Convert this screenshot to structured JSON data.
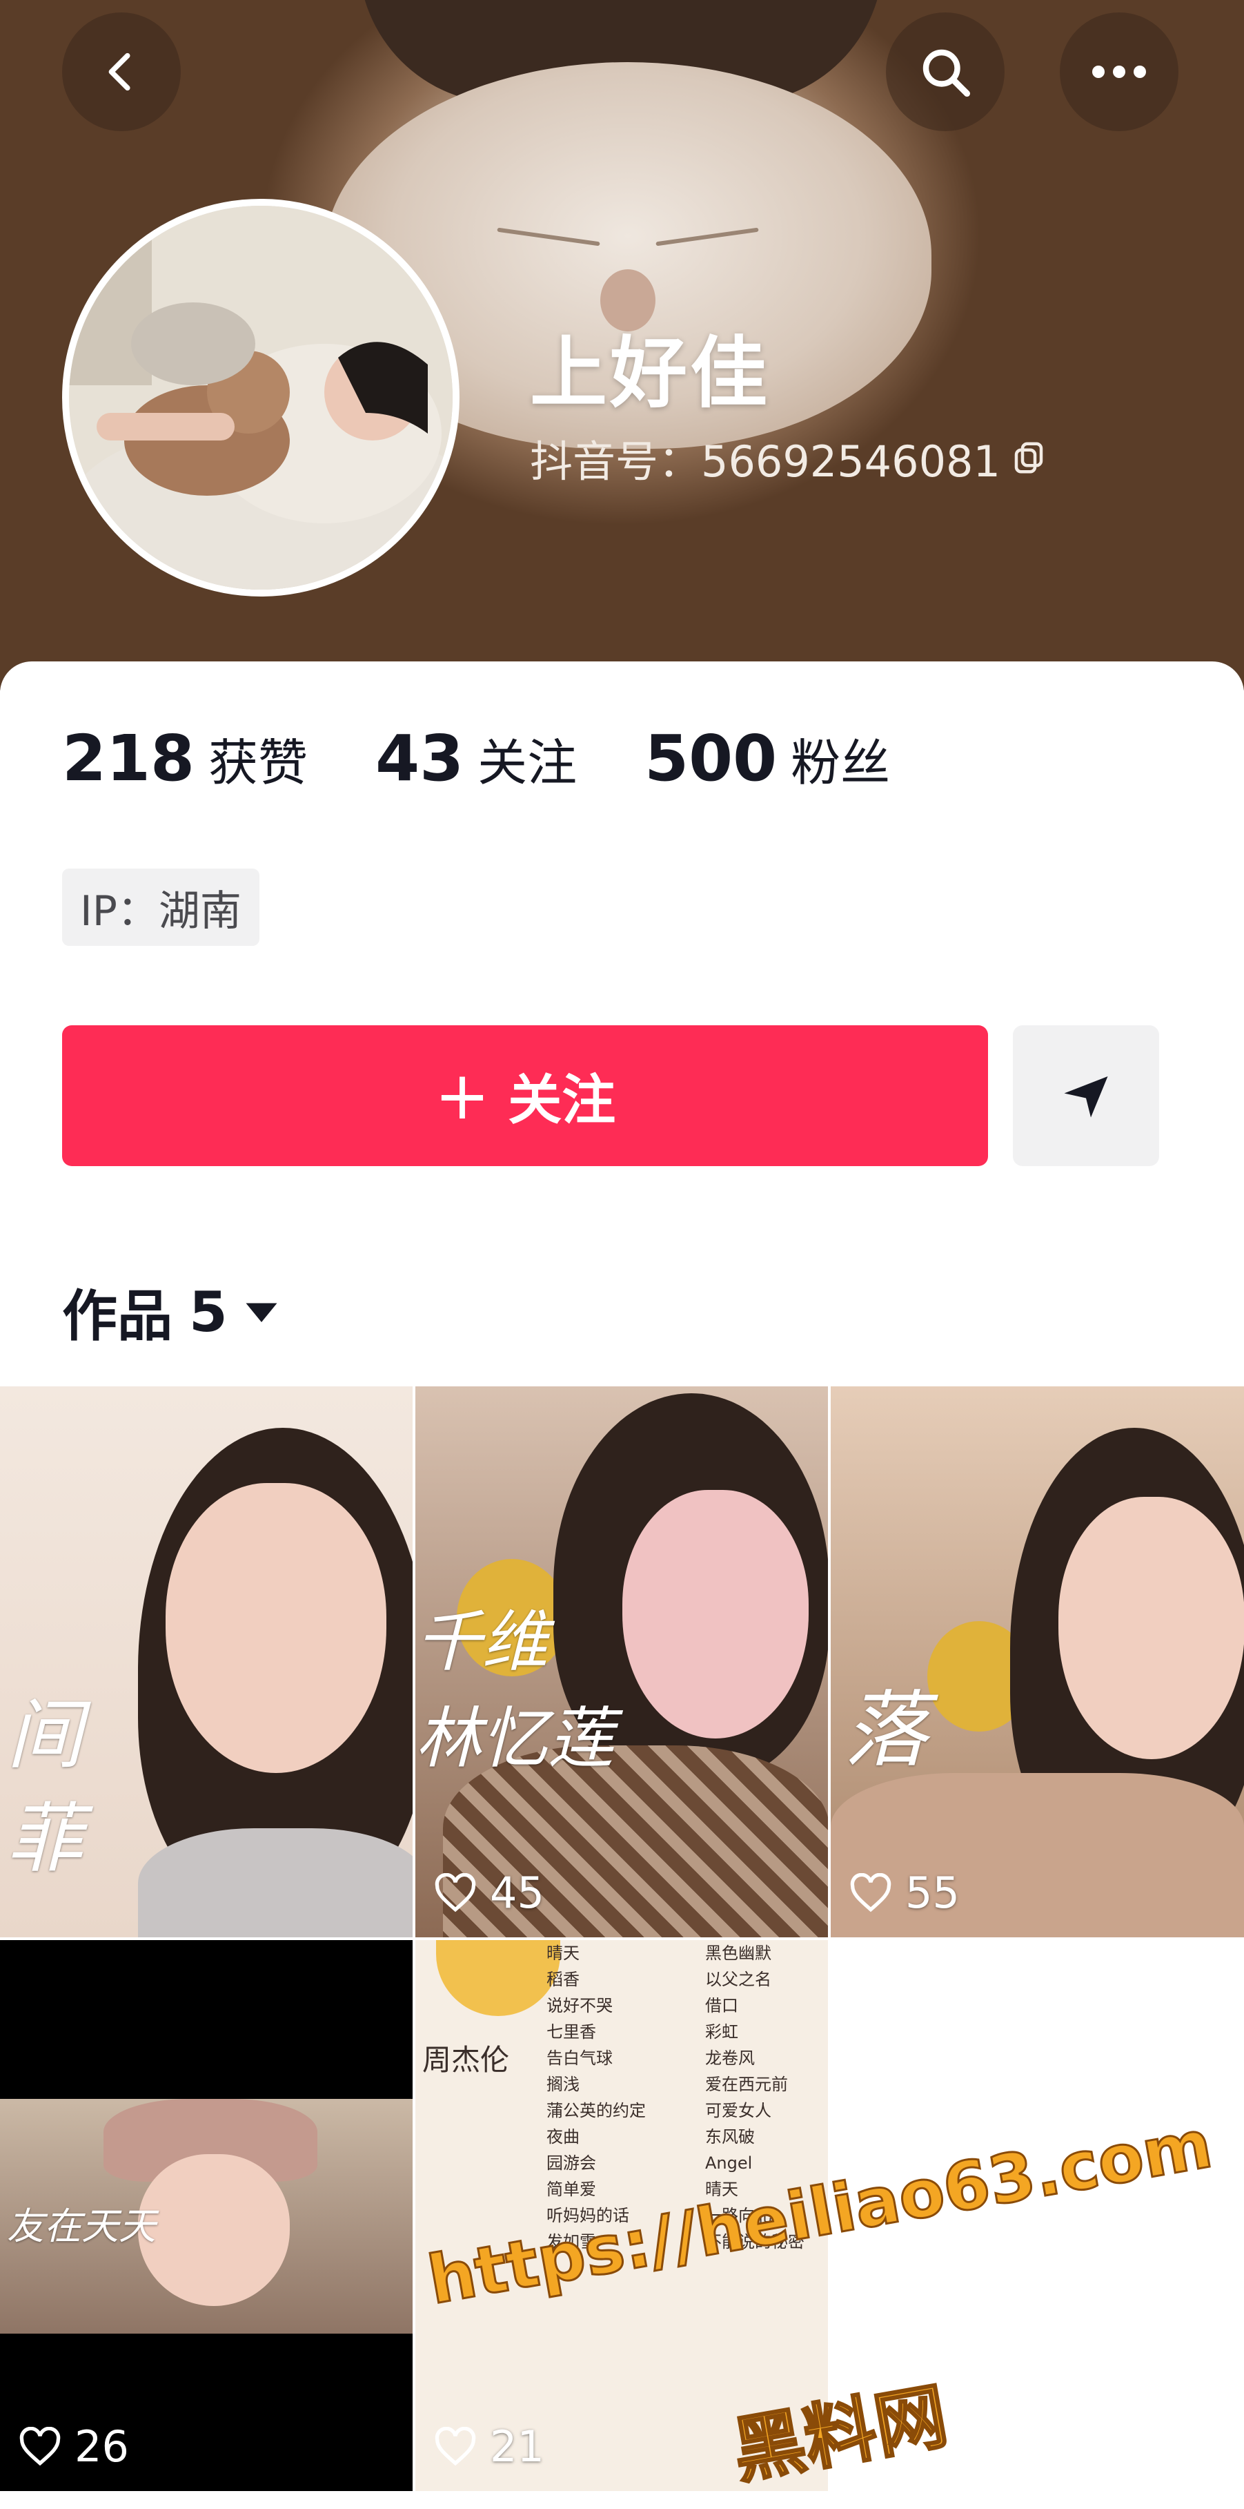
{
  "header": {
    "nickname": "上好佳",
    "douyin_id": "抖音号：56692546081"
  },
  "stats": [
    {
      "value": "218",
      "label": "获赞"
    },
    {
      "value": "43",
      "label": "关注"
    },
    {
      "value": "500",
      "label": "粉丝"
    }
  ],
  "ip_tag": "IP：湖南",
  "follow_button": {
    "plus": "+",
    "label": "关注"
  },
  "works_tab": {
    "label": "作品",
    "count": "5"
  },
  "videos": [
    {
      "likes": "",
      "overlay": "间\n菲"
    },
    {
      "likes": "45",
      "overlay": "千维\n林忆莲"
    },
    {
      "likes": "55",
      "overlay": "落"
    },
    {
      "likes": "26",
      "overlay": "友在天天"
    },
    {
      "likes": "21",
      "overlay": "周杰伦"
    }
  ],
  "video5_list_left": [
    "晴天",
    "稻香",
    "说好不哭",
    "七里香",
    "告白气球",
    "搁浅",
    "蒲公英的约定",
    "夜曲",
    "园游会",
    "简单爱",
    "听妈妈的话",
    "发如雪"
  ],
  "video5_list_right": [
    "黑色幽默",
    "以父之名",
    "借口",
    "彩虹",
    "龙卷风",
    "爱在西元前",
    "可爱女人",
    "东风破",
    "Angel",
    "晴天",
    "一路向北",
    "不能说的秘密"
  ],
  "watermark": {
    "url": "https://heiliao63.com",
    "cn": "黑料网"
  },
  "colors": {
    "accent": "#fe2c55",
    "text": "#161823",
    "tag_bg": "#f1f1f2"
  }
}
